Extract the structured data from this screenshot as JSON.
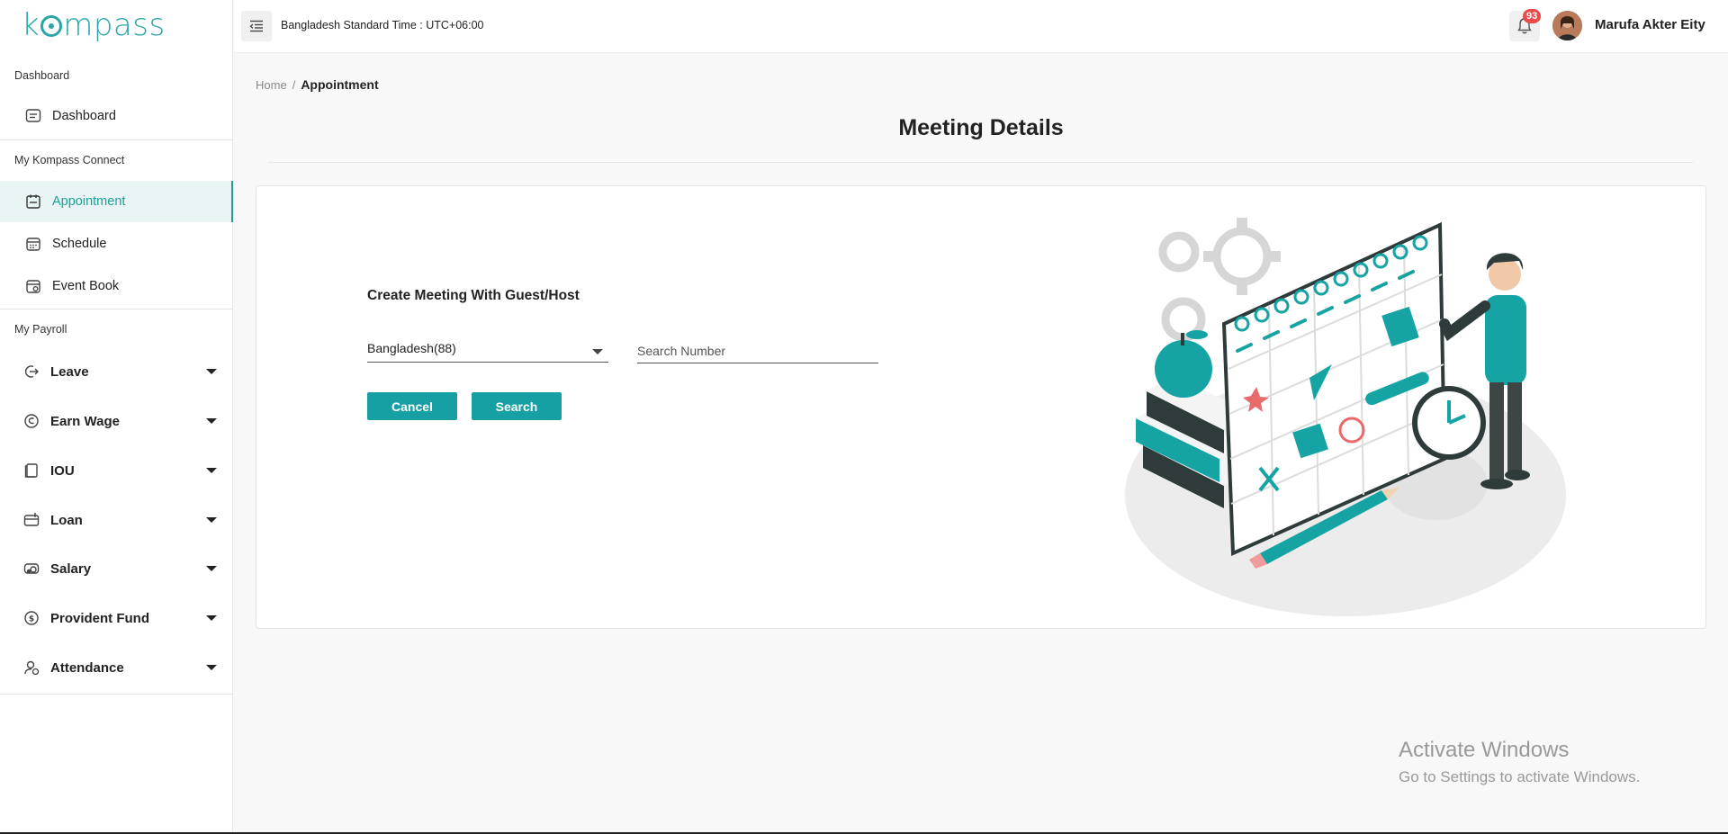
{
  "app": {
    "logo_text": "kompass"
  },
  "sidebar": {
    "sections": [
      {
        "label": "Dashboard"
      },
      {
        "label": "My Kompass Connect"
      },
      {
        "label": "My Payroll"
      }
    ],
    "items": [
      {
        "label": "Dashboard",
        "icon": "dashboard-icon"
      },
      {
        "label": "Appointment",
        "icon": "appointment-icon",
        "active": true
      },
      {
        "label": "Schedule",
        "icon": "calendar-icon"
      },
      {
        "label": "Event Book",
        "icon": "event-book-icon"
      },
      {
        "label": "Leave",
        "icon": "leave-icon",
        "expandable": true
      },
      {
        "label": "Earn Wage",
        "icon": "earn-wage-icon",
        "expandable": true
      },
      {
        "label": "IOU",
        "icon": "iou-icon",
        "expandable": true
      },
      {
        "label": "Loan",
        "icon": "loan-icon",
        "expandable": true
      },
      {
        "label": "Salary",
        "icon": "salary-icon",
        "expandable": true
      },
      {
        "label": "Provident Fund",
        "icon": "provident-fund-icon",
        "expandable": true
      },
      {
        "label": "Attendance",
        "icon": "attendance-icon",
        "expandable": true
      }
    ]
  },
  "topbar": {
    "timezone": "Bangladesh Standard Time : UTC+06:00",
    "notification_count": "93",
    "user_name": "Marufa Akter Eity"
  },
  "breadcrumb": {
    "home": "Home",
    "separator": "/",
    "current": "Appointment"
  },
  "page": {
    "title": "Meeting Details"
  },
  "form": {
    "title": "Create Meeting With Guest/Host",
    "country_select": "Bangladesh(88)",
    "search_placeholder": "Search Number",
    "search_value": "",
    "cancel_label": "Cancel",
    "search_label": "Search"
  },
  "watermark": {
    "line1": "Activate Windows",
    "line2": "Go to Settings to activate Windows."
  },
  "colors": {
    "accent": "#17a0a3",
    "badge": "#ea4b4b"
  }
}
